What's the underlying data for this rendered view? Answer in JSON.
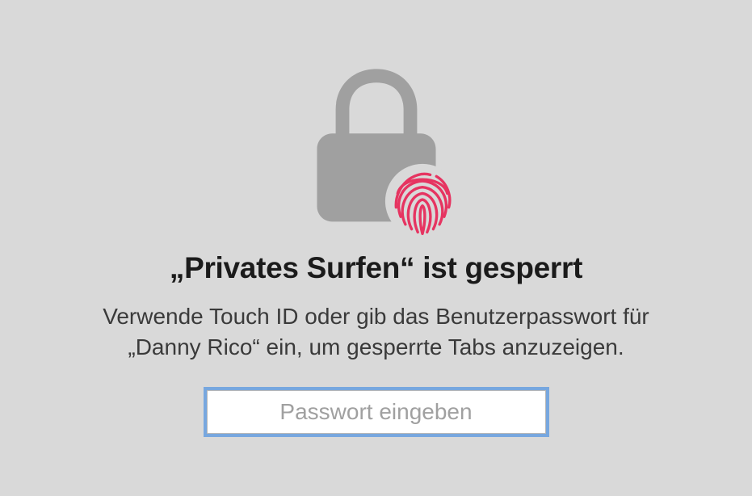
{
  "dialog": {
    "title": "„Privates Surfen“ ist gesperrt",
    "description": "Verwende Touch ID oder gib das Benutzerpasswort für „Danny Rico“ ein, um gesperrte Tabs anzuzeigen.",
    "password_placeholder": "Passwort eingeben",
    "password_value": "",
    "icon_lock": "lock-icon",
    "icon_fingerprint": "fingerprint-icon",
    "colors": {
      "background": "#d9d9d9",
      "lock": "#a0a0a0",
      "fingerprint": "#e63461",
      "focus_ring": "#77a7df"
    }
  }
}
